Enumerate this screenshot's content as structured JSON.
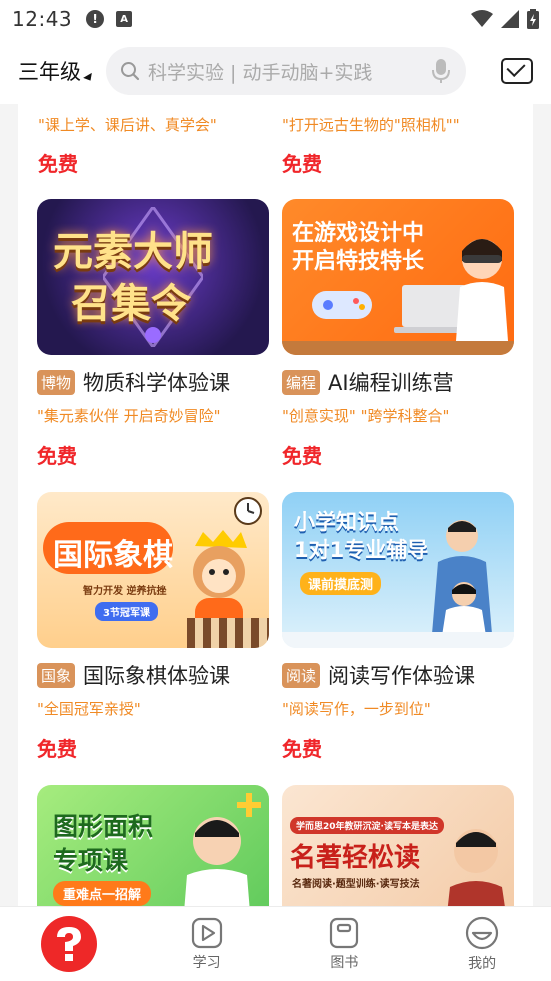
{
  "status": {
    "time": "12:43",
    "alert_glyph": "!",
    "a_glyph": "A"
  },
  "header": {
    "grade": "三年级",
    "search_placeholder": "科学实验 | 动手动脑+实践"
  },
  "top_partial": [
    {
      "subtitle": "\"课上学、课后讲、真学会\"",
      "price": "免费"
    },
    {
      "subtitle": "\"打开远古生物的\"照相机\"\"",
      "price": "免费"
    }
  ],
  "cards": [
    {
      "tag": "博物",
      "title": "物质科学体验课",
      "subtitle": "\"集元素伙伴 开启奇妙冒险\"",
      "price": "免费",
      "thumb": {
        "lines": [
          "元素大师",
          "召集令"
        ],
        "bg": "#3a2a7a"
      }
    },
    {
      "tag": "编程",
      "title": "AI编程训练营",
      "subtitle": "\"创意实现\" \"跨学科整合\"",
      "price": "免费",
      "thumb": {
        "lines": [
          "在游戏设计中",
          "开启特技特长"
        ],
        "bg": "#ff7a1a"
      }
    },
    {
      "tag": "国象",
      "title": "国际象棋体验课",
      "subtitle": "\"全国冠军亲授\"",
      "price": "免费",
      "thumb": {
        "lines": [
          "国际象棋",
          "智力开发 逆养抗挫",
          "3节冠军课"
        ],
        "bg": "#ffd9a8"
      }
    },
    {
      "tag": "阅读",
      "title": "阅读写作体验课",
      "subtitle": "\"阅读写作，一步到位\"",
      "price": "免费",
      "thumb": {
        "lines": [
          "小学知识点",
          "1对1专业辅导",
          "课前摸底测"
        ],
        "bg": "#7ec5ef"
      }
    },
    {
      "thumb": {
        "lines": [
          "图形面积",
          "专项课",
          "重难点一招解"
        ],
        "bg": "#8fe07a"
      }
    },
    {
      "thumb": {
        "lines": [
          "学而思20年教研沉淀·读写本是表达",
          "名著轻松读",
          "名著阅读·题型训练·读写技法"
        ],
        "bg": "#f6dcc4"
      }
    }
  ],
  "nav": {
    "items": [
      {
        "label": "学习"
      },
      {
        "label": "图书"
      },
      {
        "label": "我的"
      }
    ]
  },
  "colors": {
    "accent_red": "#ee2828",
    "orange": "#f08a24",
    "tag_bg": "#d9935a"
  }
}
